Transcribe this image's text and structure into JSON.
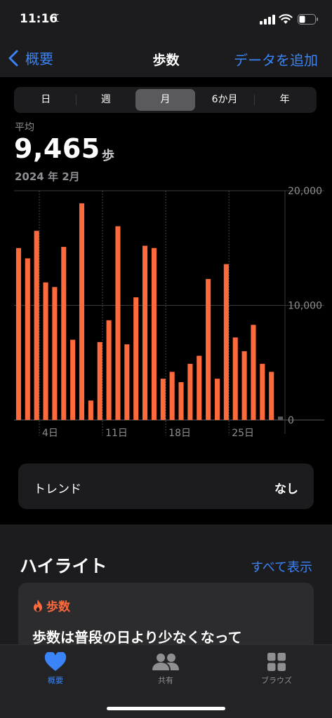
{
  "status": {
    "time": "11:16"
  },
  "nav": {
    "back_label": "概要",
    "title": "歩数",
    "add_label": "データを追加"
  },
  "segments": [
    "日",
    "週",
    "月",
    "6か月",
    "年"
  ],
  "selected_segment": "月",
  "summary": {
    "label": "平均",
    "value": "9,465",
    "unit": "歩",
    "period": "2024 年 2月"
  },
  "chart_data": {
    "type": "bar",
    "title": "",
    "xlabel": "",
    "ylabel": "",
    "ylim": [
      0,
      20000
    ],
    "y_ticks": [
      "20,000",
      "10,000",
      "0"
    ],
    "x_tick_labels": [
      "4日",
      "11日",
      "18日",
      "25日"
    ],
    "categories": [
      "1",
      "2",
      "3",
      "4",
      "5",
      "6",
      "7",
      "8",
      "9",
      "10",
      "11",
      "12",
      "13",
      "14",
      "15",
      "16",
      "17",
      "18",
      "19",
      "20",
      "21",
      "22",
      "23",
      "24",
      "25",
      "26",
      "27",
      "28",
      "29"
    ],
    "values": [
      15000,
      14100,
      16500,
      12000,
      11600,
      15100,
      7000,
      18900,
      1700,
      6800,
      8700,
      16900,
      6600,
      10700,
      15200,
      15000,
      3600,
      4200,
      3300,
      4900,
      5600,
      12300,
      3600,
      13600,
      7200,
      6000,
      8300,
      4900,
      4200
    ],
    "partial_value": 300,
    "bar_color": "#ff6a3d",
    "grid": true
  },
  "trend": {
    "label": "トレンド",
    "value": "なし"
  },
  "highlights": {
    "title": "ハイライト",
    "see_all": "すべて表示",
    "card_category": "歩数",
    "card_text": "歩数は普段の日より少なくなって"
  },
  "tabs": [
    {
      "label": "概要"
    },
    {
      "label": "共有"
    },
    {
      "label": "ブラウズ"
    }
  ],
  "colors": {
    "accent": "#3a84f7",
    "steps": "#ff6a3d"
  }
}
